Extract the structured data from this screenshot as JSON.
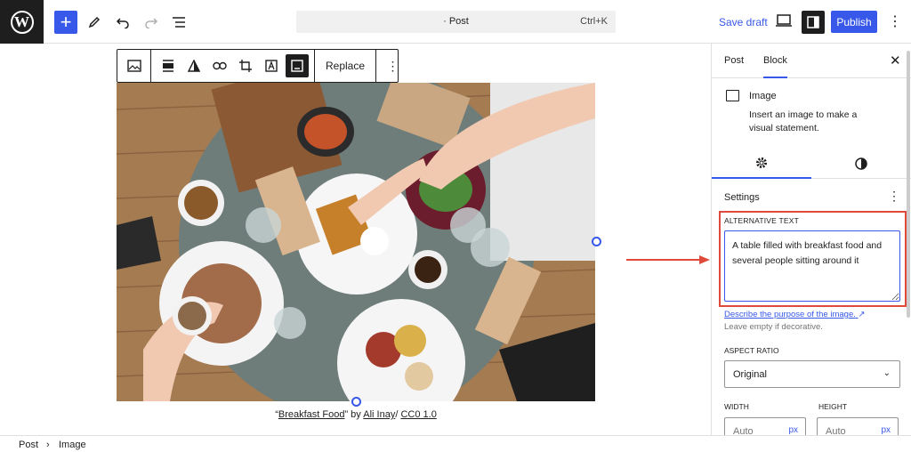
{
  "header": {
    "logo_letter": "W",
    "command_bar": {
      "label": "· Post",
      "shortcut": "Ctrl+K"
    },
    "save_draft": "Save draft",
    "publish": "Publish"
  },
  "block_toolbar": {
    "replace": "Replace"
  },
  "image": {
    "caption": {
      "quote_open": "“",
      "title": "Breakfast Food",
      "quote_close": "”",
      "by": " by ",
      "author": "Ali Inay",
      "sep": "/ ",
      "license": "CC0 1.0"
    }
  },
  "sidebar": {
    "tabs": [
      "Post",
      "Block"
    ],
    "block": {
      "title": "Image",
      "description": "Insert an image to make a visual statement."
    },
    "settings_title": "Settings",
    "alt_text": {
      "label": "ALTERNATIVE TEXT",
      "value": "A table filled with breakfast food and several people sitting around it",
      "help_link": "Describe the purpose of the image.",
      "help_link_icon": "↗",
      "help": "Leave empty if decorative."
    },
    "aspect_ratio": {
      "label": "ASPECT RATIO",
      "value": "Original"
    },
    "width": {
      "label": "WIDTH",
      "placeholder": "Auto",
      "unit": "px"
    },
    "height": {
      "label": "HEIGHT",
      "placeholder": "Auto",
      "unit": "px"
    }
  },
  "footer": {
    "breadcrumb": [
      "Post",
      "Image"
    ]
  },
  "colors": {
    "accent": "#3858e9",
    "highlight": "#e04a3c",
    "dark": "#1e1e1e"
  }
}
